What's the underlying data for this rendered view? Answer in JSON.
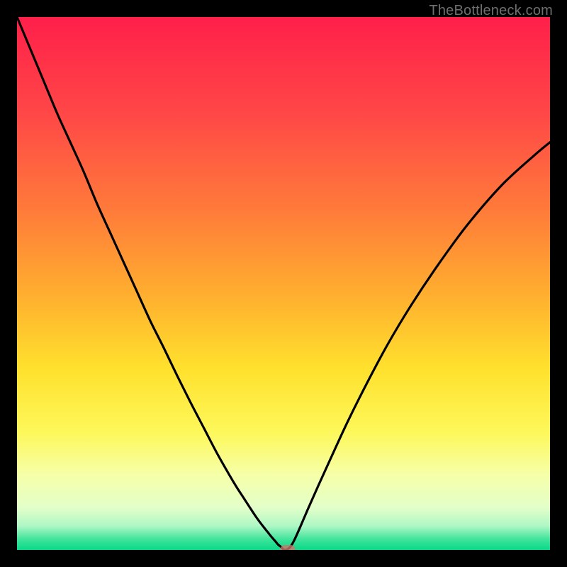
{
  "watermark": "TheBottleneck.com",
  "colors": {
    "frame": "#000000",
    "curve": "#000000",
    "marker": "#cf746b",
    "gradient_stops": [
      {
        "offset": 0,
        "color": "#ff1f4a"
      },
      {
        "offset": 0.18,
        "color": "#ff4747"
      },
      {
        "offset": 0.36,
        "color": "#ff7a3a"
      },
      {
        "offset": 0.52,
        "color": "#ffae2f"
      },
      {
        "offset": 0.66,
        "color": "#ffe12d"
      },
      {
        "offset": 0.78,
        "color": "#fdf85b"
      },
      {
        "offset": 0.86,
        "color": "#f6ffa9"
      },
      {
        "offset": 0.92,
        "color": "#e3ffc9"
      },
      {
        "offset": 0.955,
        "color": "#aef7c5"
      },
      {
        "offset": 0.98,
        "color": "#3fe49b"
      },
      {
        "offset": 1.0,
        "color": "#08d987"
      }
    ]
  },
  "chart_data": {
    "type": "line",
    "title": "",
    "xlabel": "",
    "ylabel": "",
    "xlim": [
      0,
      1
    ],
    "ylim": [
      0,
      1
    ],
    "x": [
      0.0,
      0.025,
      0.05,
      0.075,
      0.1,
      0.125,
      0.15,
      0.175,
      0.2,
      0.225,
      0.25,
      0.275,
      0.3,
      0.325,
      0.35,
      0.375,
      0.4,
      0.412,
      0.425,
      0.438,
      0.45,
      0.462,
      0.47,
      0.478,
      0.485,
      0.49,
      0.495,
      0.5,
      0.503,
      0.507,
      0.513,
      0.52,
      0.53,
      0.545,
      0.565,
      0.59,
      0.62,
      0.655,
      0.695,
      0.74,
      0.79,
      0.845,
      0.91,
      0.97,
      1.0
    ],
    "values": [
      1.0,
      0.94,
      0.88,
      0.82,
      0.765,
      0.71,
      0.65,
      0.595,
      0.54,
      0.485,
      0.43,
      0.38,
      0.328,
      0.278,
      0.23,
      0.182,
      0.138,
      0.118,
      0.098,
      0.078,
      0.06,
      0.044,
      0.034,
      0.024,
      0.016,
      0.01,
      0.006,
      0.001,
      0.0,
      0.001,
      0.006,
      0.018,
      0.04,
      0.075,
      0.12,
      0.175,
      0.24,
      0.31,
      0.385,
      0.46,
      0.535,
      0.61,
      0.685,
      0.74,
      0.765
    ],
    "series": [
      {
        "name": "bottleneck-curve",
        "x_key": "x",
        "y_key": "values"
      }
    ],
    "marker": {
      "x": 0.508,
      "y": 0.0
    },
    "grid": false,
    "legend": false
  }
}
